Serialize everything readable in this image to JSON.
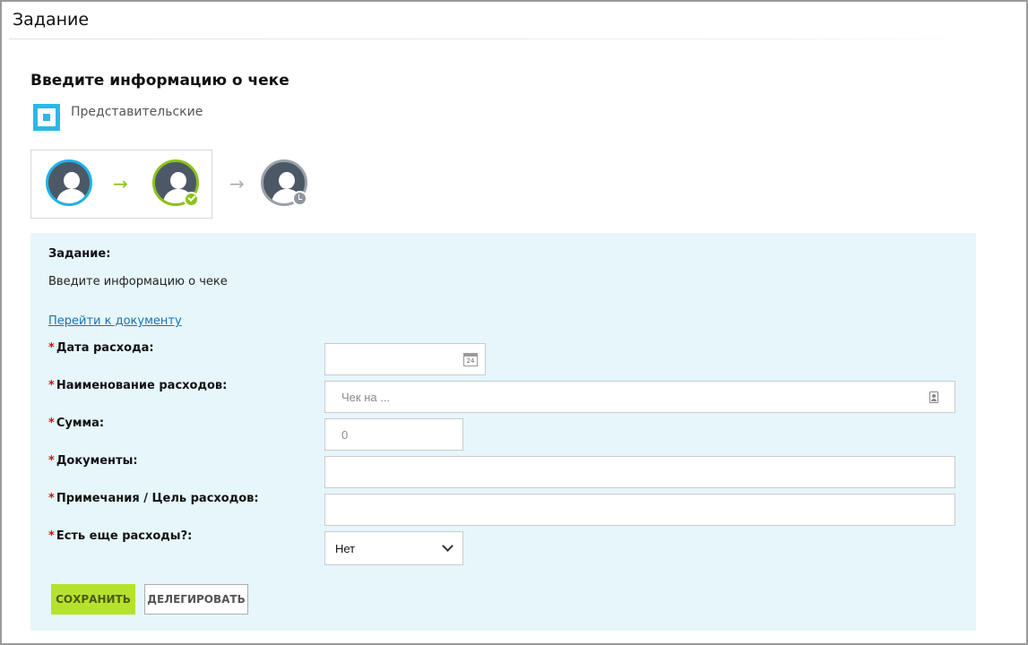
{
  "page": {
    "title": "Задание"
  },
  "header": {
    "heading": "Введите информацию о чеке",
    "category": "Представительские"
  },
  "icons": {
    "category": "category-square-icon",
    "calendar": "calendar-icon",
    "address_book": "address-book-icon",
    "chevron": "chevron-down-icon",
    "check_badge": "check-badge-icon",
    "clock_badge": "clock-badge-icon",
    "arrow": "arrow-right-icon",
    "user": "user-avatar-icon"
  },
  "calendar_day": "24",
  "workflow": {
    "steps": [
      {
        "status": "current",
        "color": "#1fb3e6"
      },
      {
        "status": "completed",
        "color": "#8cc21a"
      },
      {
        "status": "pending",
        "color": "#9aa1a8"
      }
    ],
    "arrow_symbol": "→"
  },
  "task": {
    "label": "Задание:",
    "text": "Введите информацию о чеке",
    "doc_link": "Перейти к документу"
  },
  "form": {
    "required_mark": "*",
    "fields": [
      {
        "label": "Дата расхода:",
        "value": "",
        "placeholder": ""
      },
      {
        "label": "Наименование расходов:",
        "value": "",
        "placeholder": "Чек на ..."
      },
      {
        "label": "Сумма:",
        "value": "0",
        "placeholder": ""
      },
      {
        "label": "Документы:",
        "value": "",
        "placeholder": ""
      },
      {
        "label": "Примечания / Цель расходов:",
        "value": "",
        "placeholder": ""
      },
      {
        "label": "Есть еще расходы?:",
        "value": "Нет",
        "placeholder": ""
      }
    ]
  },
  "buttons": {
    "save": "СОХРАНИТЬ",
    "delegate": "ДЕЛЕГИРОВАТЬ"
  },
  "colors": {
    "accent_blue": "#1fb3e6",
    "accent_green": "#8cc21a",
    "panel_bg": "#e6f6fb",
    "save_bg": "#b6e22e",
    "link": "#1a73b8",
    "required": "#d0101c"
  }
}
